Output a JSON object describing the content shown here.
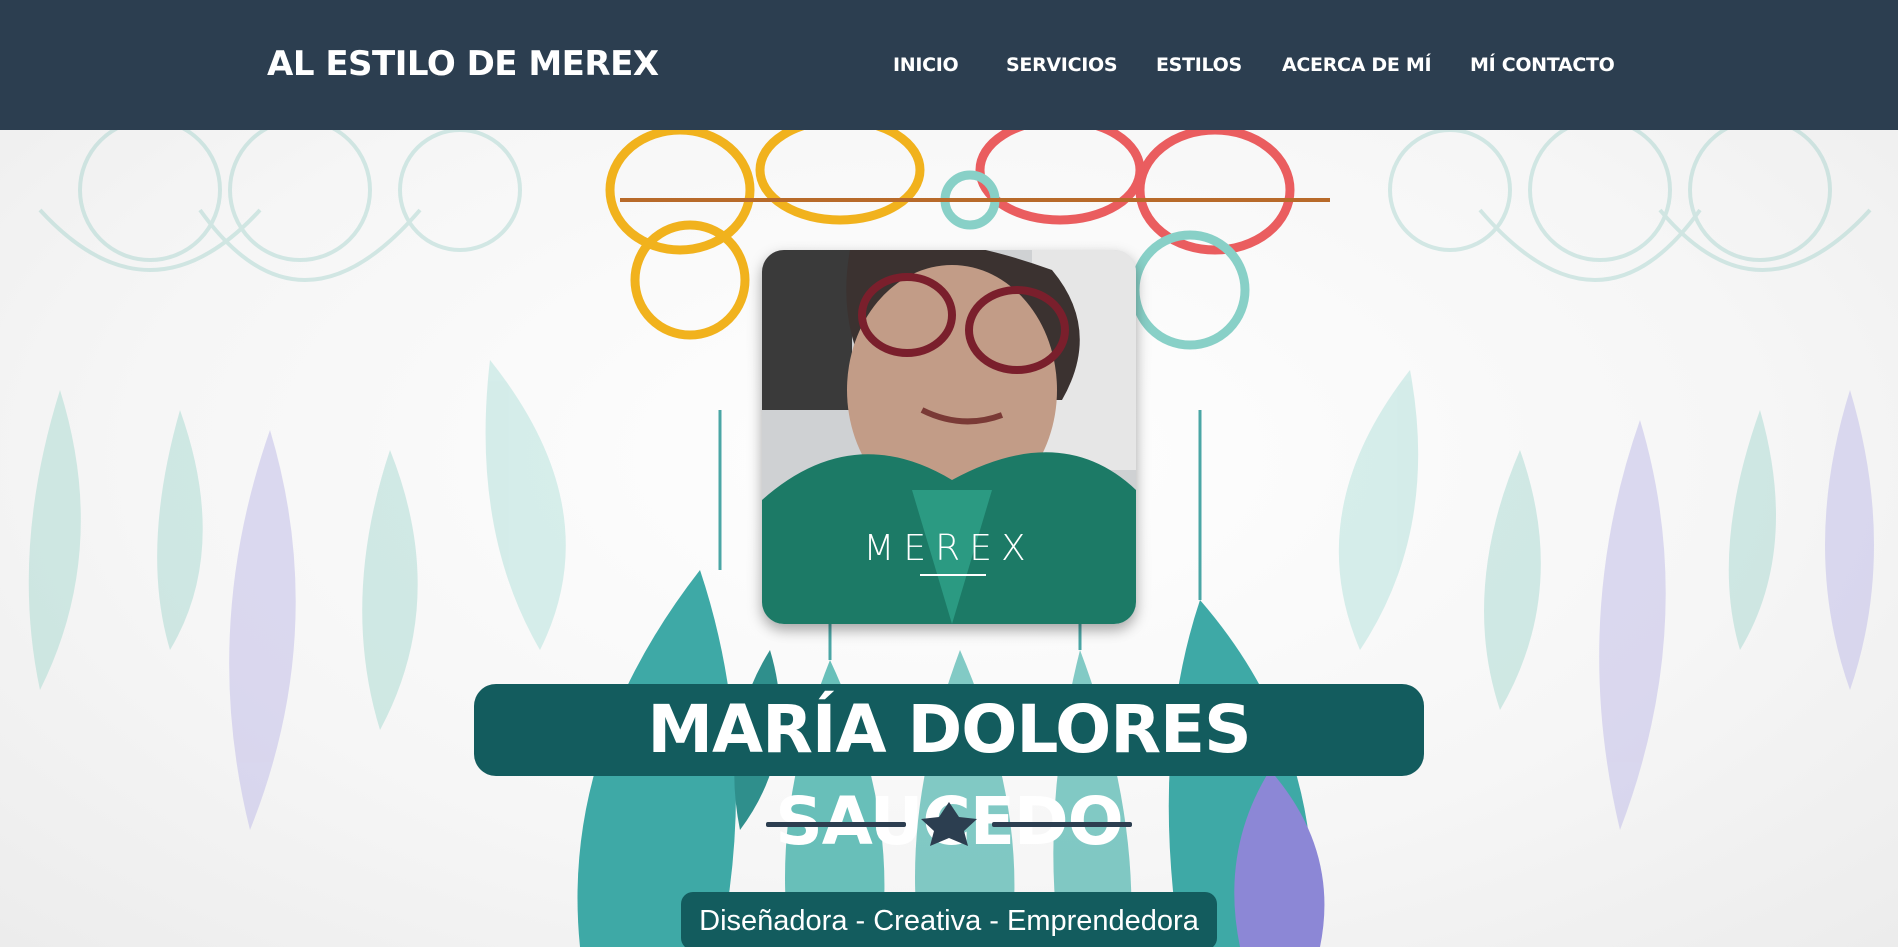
{
  "header": {
    "brand": "AL ESTILO DE MEREX",
    "nav": [
      {
        "label": "INICIO"
      },
      {
        "label": "SERVICIOS"
      },
      {
        "label": "ESTILOS"
      },
      {
        "label": "ACERCA DE MÍ"
      },
      {
        "label": "MÍ CONTACTO"
      }
    ]
  },
  "hero": {
    "photo_caption": "MEREX",
    "name": "MARÍA DOLORES SAUCEDO",
    "divider_icon": "star-icon",
    "tagline": "Diseñadora - Creativa - Emprendedora"
  },
  "colors": {
    "navbar": "#2c3e50",
    "accent": "#135c5e",
    "divider": "#2c3e50"
  }
}
